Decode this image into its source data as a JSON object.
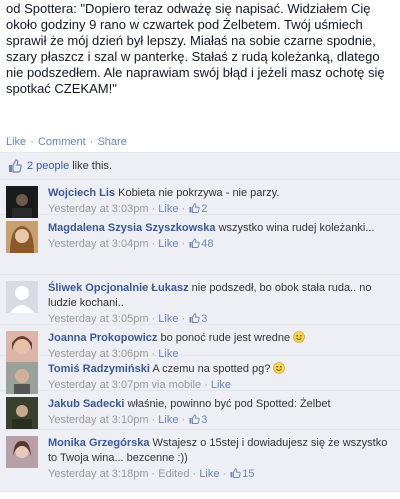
{
  "post": {
    "text": "od Spottera: \"Dopiero teraz odważę się napisać. Widziałem Cię około godziny 9 rano w czwartek pod Żelbetem. Twój uśmiech sprawił że mój dzień był lepszy. Miałaś na sobie czarne spodnie, szary płaszcz i szal w panterkę. Stałaś z rudą koleżanką, dlatego nie podszedłem. Ale naprawiam swój błąd i jeżeli masz ochotę się spotkać CZEKAM!\""
  },
  "actions": {
    "like": "Like",
    "comment": "Comment",
    "share": "Share",
    "sep": "·"
  },
  "likes_summary": {
    "people": "2 people",
    "suffix": "like this."
  },
  "colors": {
    "link": "#3b5998",
    "ufi_bg": "#edeff4",
    "meta": "#999999"
  },
  "comments": [
    {
      "author": "Wojciech Lis",
      "text": "Kobieta nie pokrzywa - nie parzy.",
      "time": "Yesterday at 3:03pm",
      "like": "Like",
      "likes": "2"
    },
    {
      "author": "Magdalena Szysia Szyszkowska",
      "text": "wszystko wina rudej koleżanki...",
      "time": "Yesterday at 3:04pm",
      "like": "Like",
      "likes": "48"
    },
    {
      "author": "Śliwek Opcjonalnie Łukasz",
      "text": "nie podszedł, bo obok stała ruda.. no ludzie kochani..",
      "time": "Yesterday at 3:05pm",
      "like": "Like",
      "likes": "3"
    },
    {
      "author": "Joanna Prokopowicz",
      "text": "bo ponoć rude jest wredne",
      "time": "Yesterday at 3:06pm",
      "like": "Like",
      "likes": ""
    },
    {
      "author": "Tomiś Radzymiński",
      "text": "A czemu na spotted pg?",
      "time": "Yesterday at 3:07pm via mobile",
      "like": "Like",
      "likes": ""
    },
    {
      "author": "Jakub Sadecki",
      "text": "właśnie, powinno być pod Spotted: Żelbet",
      "time": "Yesterday at 3:10pm",
      "like": "Like",
      "likes": "3"
    },
    {
      "author": "Monika Grzegórska",
      "text": "Wstajesz o 15stej i dowiadujesz się że wszystko to Twoja wina... bezcenne :))",
      "time": "Yesterday at 3:18pm",
      "edited": "Edited",
      "like": "Like",
      "likes": "15"
    }
  ]
}
